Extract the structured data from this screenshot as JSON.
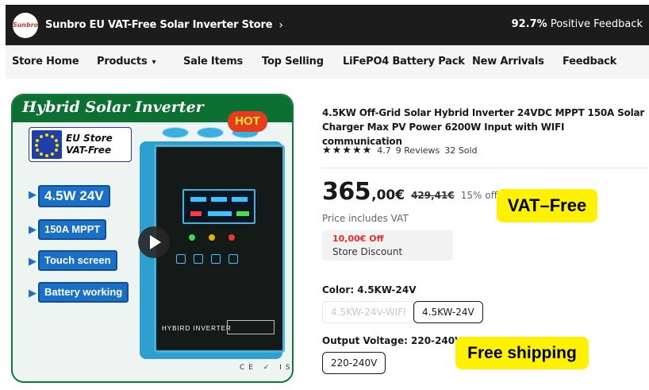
{
  "store": {
    "logo_text": "Sunbro",
    "name": "Sunbro EU VAT-Free Solar Inverter Store",
    "feedback_percent": "92.7%",
    "feedback_label": "Positive Feedback"
  },
  "nav": {
    "items": [
      "Store Home",
      "Products",
      "Sale Items",
      "Top Selling",
      "LiFePO4 Battery Pack",
      "New Arrivals",
      "Feedback"
    ]
  },
  "product_image": {
    "banner": "Hybrid Solar Inverter",
    "eu_store_line1": "EU Store",
    "eu_store_line2": "VAT-Free",
    "hot": "HOT",
    "badges": [
      "4.5W 24V",
      "150A MPPT",
      "Touch screen",
      "Battery working"
    ],
    "inverter_label": "HYBIRD  INVERTER",
    "cert_marks": "CE ✓ ISO"
  },
  "product": {
    "title": "4.5KW Off-Grid Solar Hybrid Inverter 24VDC MPPT 150A Solar Charger Max PV Power 6200W Input with WIFI communication",
    "stars": "★★★★★",
    "rating": "4.7",
    "reviews": "9 Reviews",
    "sold": "32 Sold",
    "price_whole": "365",
    "price_decimal": ",00€",
    "price_old": "429,41€",
    "price_off": "15% off",
    "vat_note": "Price includes VAT",
    "vat_free_badge": "VAT–Free",
    "discount_amount": "10,00€ Off",
    "discount_label": "Store Discount",
    "color_label": "Color: 4.5KW-24V",
    "color_options": [
      "4.5KW-24V-WIFI",
      "4.5KW-24V"
    ],
    "voltage_label": "Output Voltage: 220-240V",
    "voltage_options": [
      "220-240V"
    ],
    "free_shipping_badge": "Free shipping"
  }
}
